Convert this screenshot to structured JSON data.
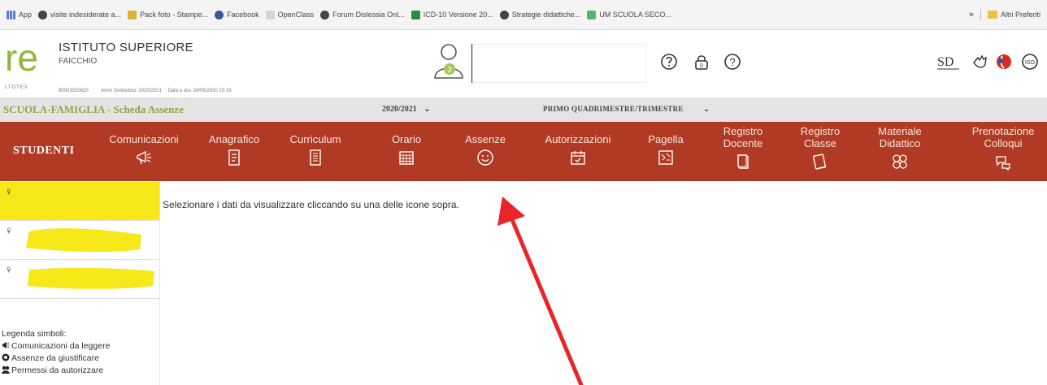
{
  "bookmarks": {
    "items": [
      {
        "label": "App",
        "icon": "apps-grid-icon",
        "color": "#5b7bd5"
      },
      {
        "label": "visite indesiderate a...",
        "icon": "globe-icon",
        "color": "#333333"
      },
      {
        "label": "Pack foto - Stampe...",
        "icon": "photo-icon",
        "color": "#d9b43a"
      },
      {
        "label": "Facebook",
        "icon": "facebook-icon",
        "color": "#3b5998"
      },
      {
        "label": "OpenClass",
        "icon": "openclass-icon",
        "color": "#9bb3c9"
      },
      {
        "label": "Forum Dislessia Onl...",
        "icon": "globe-icon",
        "color": "#333333"
      },
      {
        "label": "ICD-10 Versione 20...",
        "icon": "sheet-icon",
        "color": "#2e8b3a"
      },
      {
        "label": "Strategie didattiche...",
        "icon": "globe-icon",
        "color": "#333333"
      },
      {
        "label": "UM SCUOLA SECO...",
        "icon": "bookmark-icon",
        "color": "#58b36b"
      }
    ],
    "more": "»",
    "other": "Altri Preferiti"
  },
  "header": {
    "logo_text": "re",
    "logo_sub": "LTOTEX",
    "school_name": "ISTITUTO SUPERIORE",
    "school_city": "FAICCHIO",
    "school_code": "90003320620",
    "school_year_label": "Anno Scolastico: 2020/2021",
    "datetime_label": "Data e ora: 24/09/2020 23:19",
    "user_badge": "3",
    "icons": [
      "help-circle-icon",
      "lock-icon",
      "question-icon",
      "sd-icon",
      "hand-icon",
      "flag-icon",
      "iso-icon"
    ],
    "sd_text": "SD",
    "iso_text": "ISO"
  },
  "section": {
    "title": "SCUOLA-FAMIGLIA - Scheda Assenze",
    "year": "2020/2021",
    "period": "PRIMO QUADRIMESTRE/TRIMESTRE",
    "dropdown_glyph": "⌄"
  },
  "nav": {
    "students_label": "STUDENTI",
    "items": [
      {
        "label": "Comunicazioni",
        "icon": "megaphone-icon"
      },
      {
        "label": "Anagrafico",
        "icon": "id-card-icon"
      },
      {
        "label": "Curriculum",
        "icon": "document-icon"
      },
      {
        "label": "Orario",
        "icon": "timetable-icon"
      },
      {
        "label": "Assenze",
        "icon": "smiley-icon"
      },
      {
        "label": "Autorizzazioni",
        "icon": "calendar-check-icon"
      },
      {
        "label": "Pagella",
        "icon": "report-card-icon"
      },
      {
        "label": "Registro Docente",
        "icon": "book-icon"
      },
      {
        "label": "Registro Classe",
        "icon": "tablet-icon"
      },
      {
        "label": "Materiale Didattico",
        "icon": "materials-icon"
      },
      {
        "label": "Prenotazione Colloqui",
        "icon": "chat-bubbles-icon"
      }
    ]
  },
  "students": [
    {
      "gender_symbol": "♀",
      "highlight": "#f7e81a"
    },
    {
      "gender_symbol": "♀",
      "highlight": "#f7e81a"
    },
    {
      "gender_symbol": "♀",
      "highlight": "#f7e81a"
    }
  ],
  "content": {
    "message": "Selezionare i dati da visualizzare cliccando su una delle icone sopra."
  },
  "legend": {
    "title": "Legenda simboli:",
    "items": [
      {
        "label": "Comunicazioni da leggere",
        "icon": "megaphone-icon"
      },
      {
        "label": "Assenze da giustificare",
        "icon": "alert-icon"
      },
      {
        "label": "Permessi da autorizzare",
        "icon": "permission-icon"
      }
    ]
  },
  "colors": {
    "nav_background": "#b03a23",
    "section_title": "#8ea64a",
    "arrow": "#e8262a",
    "highlight": "#f7e81a"
  }
}
